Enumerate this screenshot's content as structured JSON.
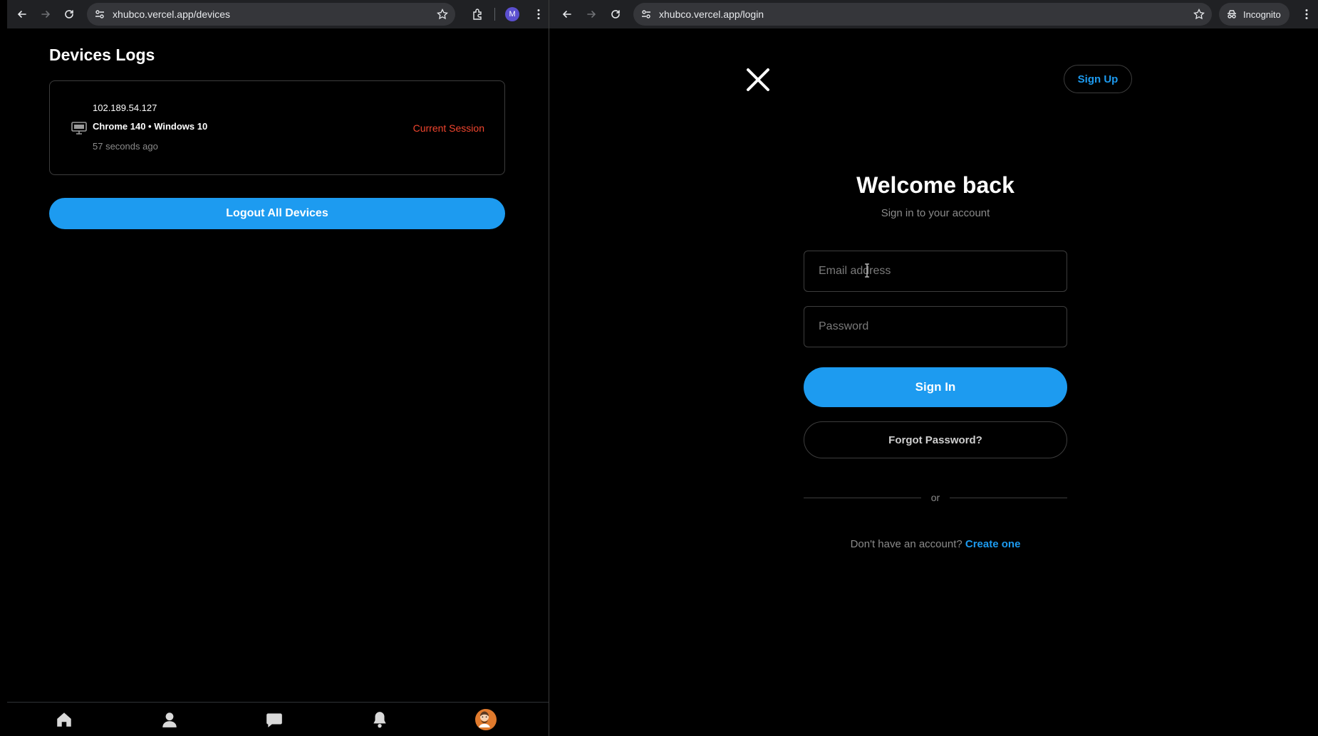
{
  "left_window": {
    "url": "xhubco.vercel.app/devices",
    "profile_initial": "M",
    "page": {
      "title": "Devices Logs",
      "device": {
        "ip": "102.189.54.127",
        "name": "Chrome 140 • Windows 10",
        "time": "57 seconds ago",
        "status": "Current Session"
      },
      "logout_label": "Logout All Devices"
    },
    "bottom_nav": [
      {
        "icon": "home-icon"
      },
      {
        "icon": "profile-icon"
      },
      {
        "icon": "chat-icon"
      },
      {
        "icon": "bell-icon"
      },
      {
        "icon": "avatar"
      }
    ]
  },
  "right_window": {
    "url": "xhubco.vercel.app/login",
    "incognito_label": "Incognito",
    "page": {
      "signup_top_label": "Sign Up",
      "welcome_title": "Welcome back",
      "welcome_subtitle": "Sign in to your account",
      "email_placeholder": "Email address",
      "password_placeholder": "Password",
      "signin_label": "Sign In",
      "forgot_label": "Forgot Password?",
      "or_text": "or",
      "no_account_text": "Don't have an account?",
      "create_link": "Create one"
    }
  },
  "colors": {
    "accent": "#1d9bf0",
    "status_red": "#f0452e",
    "chrome_bar": "#202124"
  }
}
